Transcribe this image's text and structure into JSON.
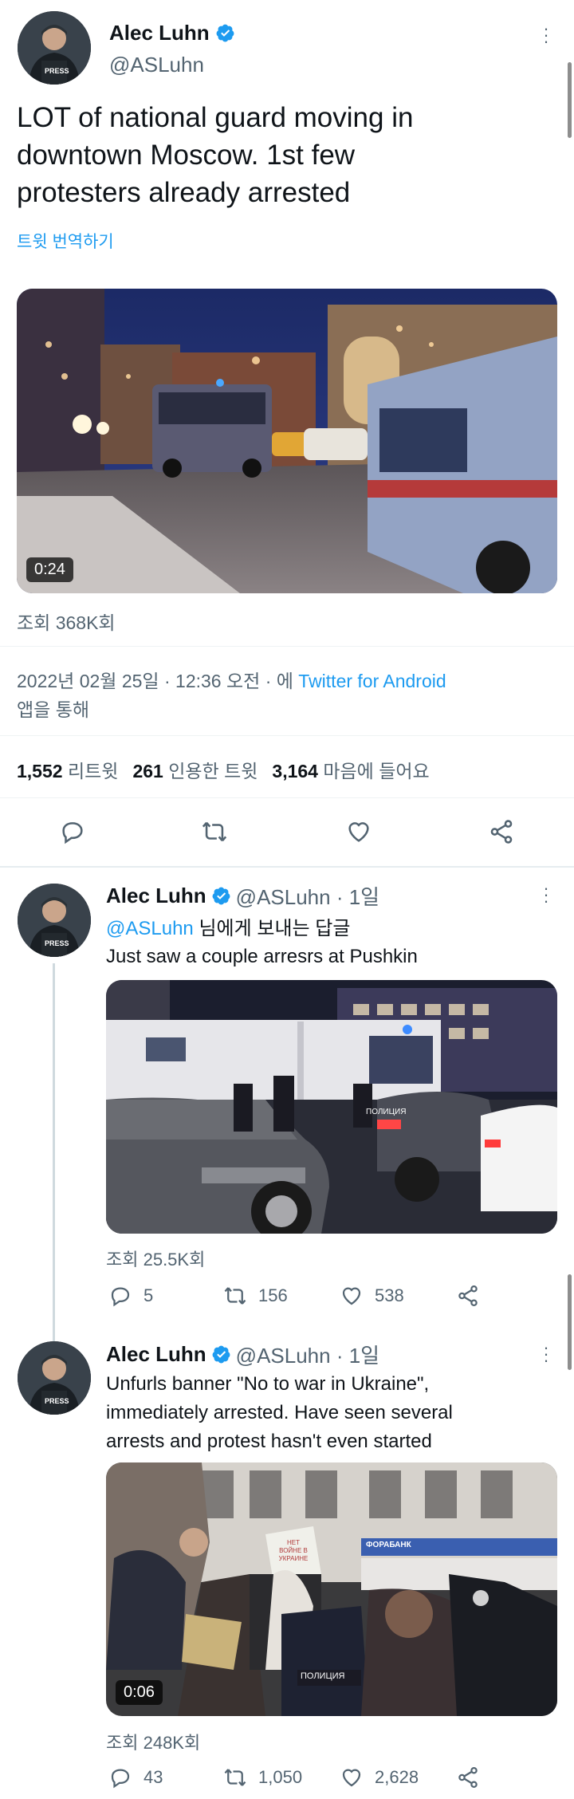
{
  "main_tweet": {
    "author_name": "Alec Luhn",
    "handle": "@ASLuhn",
    "text_line1": "LOT of national guard moving in",
    "text_line2": "downtown Moscow. 1st few",
    "text_line3": "protesters already arrested",
    "translate_label": "트윗 번역하기",
    "video_duration": "0:24",
    "views": "조회 368K회",
    "timestamp": "2022년 02월 25일 · 12:36 오전 · 에",
    "source_link": "Twitter for Android",
    "source_suffix": "앱을 통해",
    "retweets_count": "1,552",
    "retweets_label": "리트윗",
    "quotes_count": "261",
    "quotes_label": "인용한 트윗",
    "likes_count": "3,164",
    "likes_label": "마음에 들어요",
    "avatar_badge": "PRESS"
  },
  "reply1": {
    "author_name": "Alec Luhn",
    "handle_time": "@ASLuhn · 1일",
    "reply_to_handle": "@ASLuhn",
    "reply_to_suffix": "님에게 보내는 답글",
    "text": "Just saw a couple arresrs at Pushkin",
    "views": "조회 25.5K회",
    "replies": "5",
    "retweets": "156",
    "likes": "538",
    "avatar_badge": "PRESS"
  },
  "reply2": {
    "author_name": "Alec Luhn",
    "handle_time": "@ASLuhn · 1일",
    "text_line1": "Unfurls banner \"No to war in Ukraine\",",
    "text_line2": "immediately arrested. Have seen several",
    "text_line3": "arrests and protest hasn't even started",
    "video_duration": "0:06",
    "views": "조회 248K회",
    "replies": "43",
    "retweets": "1,050",
    "likes": "2,628",
    "avatar_badge": "PRESS",
    "sign_text": "НЕТ ВОЙНЕ В УКРАИНЕ",
    "bank_sign": "ФОРАБАНК",
    "police_text": "ПОЛИЦИЯ"
  },
  "reply1_image": {
    "police_text": "ПОЛИЦИЯ"
  },
  "colors": {
    "accent": "#1d9bf0",
    "muted": "#536471",
    "text": "#0f1419",
    "divider": "#eff3f4"
  }
}
